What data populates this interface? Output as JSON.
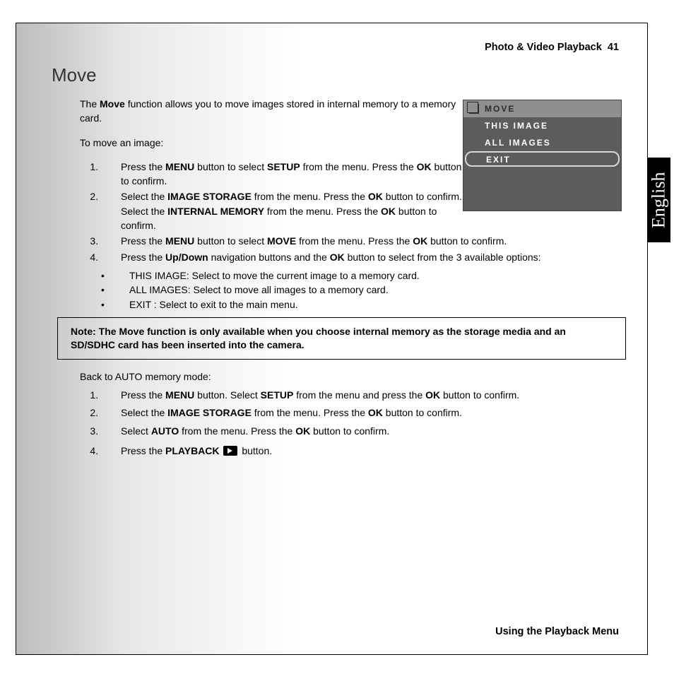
{
  "header": {
    "section": "Photo & Video Playback",
    "page": "41"
  },
  "language_tab": "English",
  "title": "Move",
  "intro": {
    "p1_pre": "The ",
    "p1_b1": "Move",
    "p1_post": " function allows you to move images stored in internal memory to a memory card.",
    "p2": "To move an image:"
  },
  "steps_a": {
    "s1": {
      "t1": "Press the ",
      "b1": "MENU",
      "t2": " button to select ",
      "b2": "SETUP",
      "t3": " from the menu. Press the ",
      "b3": "OK",
      "t4": " button to confirm."
    },
    "s2": {
      "t1": "Select the ",
      "b1": "IMAGE STORAGE",
      "t2": " from the menu. Press the ",
      "b2": "OK",
      "t3": " button to confirm. Select the ",
      "b3": "INTERNAL MEMORY",
      "t4": " from the menu. Press the ",
      "b4": "OK",
      "t5": " button to confirm."
    },
    "s3": {
      "t1": "Press the ",
      "b1": "MENU",
      "t2": " button to select ",
      "b2": "MOVE",
      "t3": " from the menu. Press the ",
      "b3": "OK",
      "t4": " button to confirm."
    },
    "s4": {
      "t1": "Press the ",
      "b1": "Up/Down",
      "t2": " navigation buttons and the ",
      "b2": "OK",
      "t3": " button to select from the 3 available options:"
    }
  },
  "bullets": {
    "b1": "THIS IMAGE: Select to move the current image to a memory card.",
    "b2": "ALL IMAGES: Select to move all images to a memory card.",
    "b3": "EXIT : Select to exit to the main menu."
  },
  "note": "Note: The Move function is only available when you choose internal memory as the storage media and an SD/SDHC card has been inserted into the camera.",
  "back_intro": "Back to AUTO memory mode:",
  "steps_b": {
    "s1": {
      "t1": "Press the ",
      "b1": "MENU",
      "t2": " button. Select ",
      "b2": "SETUP",
      "t3": " from the menu and press the ",
      "b3": "OK",
      "t4": " button to confirm."
    },
    "s2": {
      "t1": "Select the ",
      "b1": "IMAGE STORAGE",
      "t2": " from the menu. Press the ",
      "b2": "OK",
      "t3": " button to confirm."
    },
    "s3": {
      "t1": "Select ",
      "b1": "AUTO",
      "t2": " from the menu. Press the ",
      "b2": "OK",
      "t3": " button to confirm."
    },
    "s4": {
      "t1": "Press the ",
      "b1": "PLAYBACK",
      "t2": " button."
    }
  },
  "lcd": {
    "title": "MOVE",
    "opt1": "THIS IMAGE",
    "opt2": "ALL IMAGES",
    "opt3": "EXIT"
  },
  "footer": "Using the Playback Menu"
}
